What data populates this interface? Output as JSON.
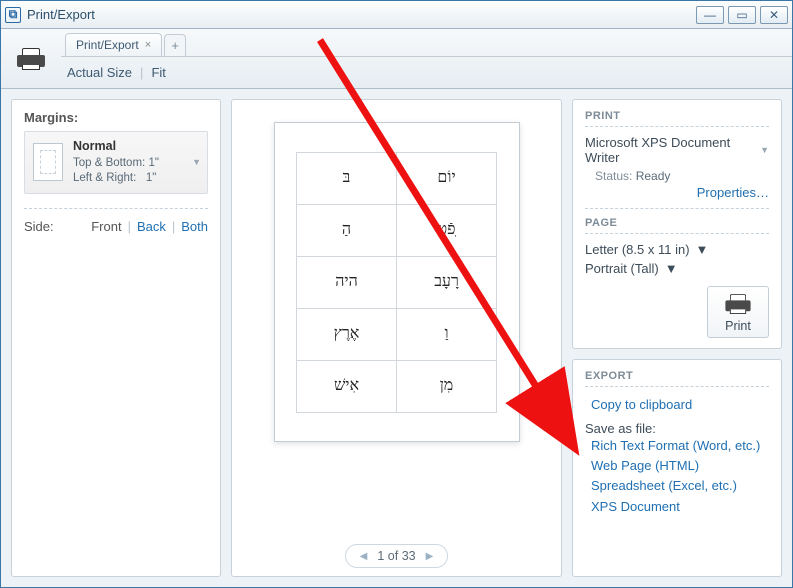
{
  "window": {
    "title": "Print/Export"
  },
  "tabs": {
    "main": "Print/Export"
  },
  "viewbar": {
    "actual": "Actual Size",
    "fit": "Fit"
  },
  "left": {
    "margins_label": "Margins:",
    "margin_name": "Normal",
    "tb_label": "Top & Bottom:",
    "tb_value": "1\"",
    "lr_label": "Left & Right:",
    "lr_value": "1\"",
    "side_label": "Side:",
    "front": "Front",
    "back": "Back",
    "both": "Both"
  },
  "preview": {
    "cells": [
      "בּ",
      "יוֹם",
      "הַ",
      "ִפֿט",
      "היה",
      "רָעָב",
      "אֶרֶץ",
      "וַ",
      "אִישׁ",
      "מִן"
    ],
    "pager": "1 of 33"
  },
  "print": {
    "heading": "PRINT",
    "printer": "Microsoft XPS Document Writer",
    "status_label": "Status:",
    "status_value": "Ready",
    "properties": "Properties…",
    "page_heading": "PAGE",
    "paper": "Letter (8.5 x 11 in)",
    "orient": "Portrait (Tall)",
    "button": "Print"
  },
  "export": {
    "heading": "EXPORT",
    "copy": "Copy to clipboard",
    "save_label": "Save as file:",
    "rtf": "Rich Text Format (Word, etc.)",
    "html": "Web Page (HTML)",
    "xls": "Spreadsheet (Excel, etc.)",
    "xps": "XPS Document"
  }
}
